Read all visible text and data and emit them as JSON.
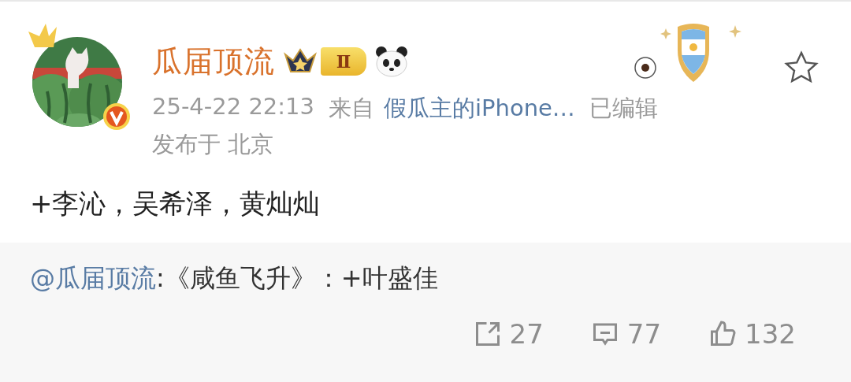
{
  "post": {
    "author": {
      "name": "瓜届顶流",
      "level_badge": "Ⅱ",
      "verified": true
    },
    "favorited": false,
    "meta": {
      "time": "25-4-22 22:13",
      "source_prefix": "来自",
      "source": "假瓜主的iPhone…",
      "edited": "已编辑",
      "location": "发布于 北京"
    },
    "text": "+李沁，吴希泽，黄灿灿"
  },
  "repost": {
    "mention": "@瓜届顶流",
    "text": ":《咸鱼飞升》：+叶盛佳"
  },
  "actions": [
    {
      "kind": "repost",
      "count": "27"
    },
    {
      "kind": "comment",
      "count": "77"
    },
    {
      "kind": "like",
      "count": "132"
    }
  ]
}
